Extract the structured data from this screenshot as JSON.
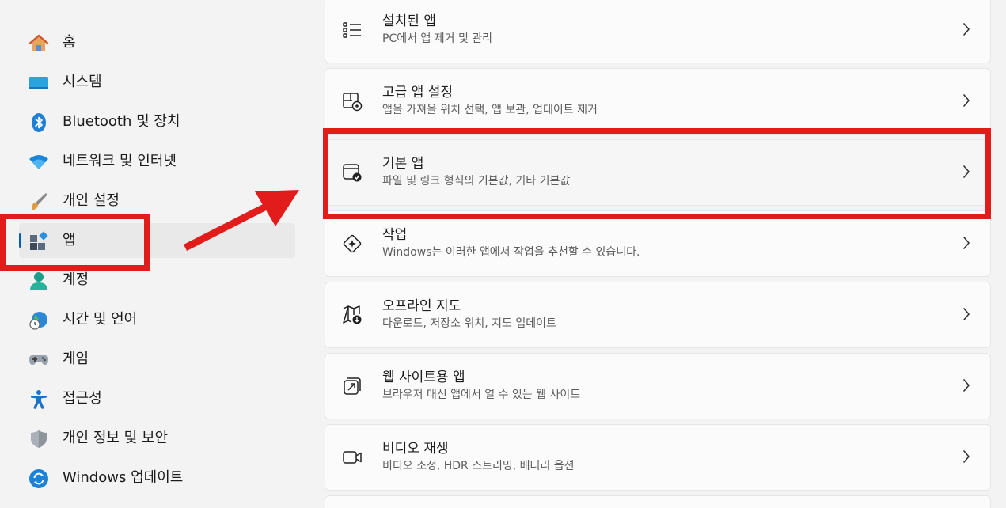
{
  "sidebar": {
    "items": [
      {
        "label": "홈",
        "icon": "home-icon"
      },
      {
        "label": "시스템",
        "icon": "system-icon"
      },
      {
        "label": "Bluetooth 및 장치",
        "icon": "bluetooth-icon"
      },
      {
        "label": "네트워크 및 인터넷",
        "icon": "wifi-icon"
      },
      {
        "label": "개인 설정",
        "icon": "brush-icon"
      },
      {
        "label": "앱",
        "icon": "apps-icon",
        "selected": true
      },
      {
        "label": "계정",
        "icon": "account-icon"
      },
      {
        "label": "시간 및 언어",
        "icon": "globe-clock-icon"
      },
      {
        "label": "게임",
        "icon": "gamepad-icon"
      },
      {
        "label": "접근성",
        "icon": "accessibility-icon"
      },
      {
        "label": "개인 정보 및 보안",
        "icon": "shield-icon"
      },
      {
        "label": "Windows 업데이트",
        "icon": "update-icon"
      }
    ]
  },
  "main": {
    "cards": [
      {
        "title": "설치된 앱",
        "subtitle": "PC에서 앱 제거 및 관리",
        "icon": "list-icon"
      },
      {
        "title": "고급 앱 설정",
        "subtitle": "앱을 가져올 위치 선택, 앱 보관, 업데이트 제거",
        "icon": "advanced-apps-icon"
      },
      {
        "title": "기본 앱",
        "subtitle": "파일 및 링크 형식의 기본값, 기타 기본값",
        "icon": "default-apps-icon"
      },
      {
        "title": "작업",
        "subtitle": "Windows는 이러한 앱에서 작업을 추천할 수 있습니다.",
        "icon": "actions-icon"
      },
      {
        "title": "오프라인 지도",
        "subtitle": "다운로드, 저장소 위치, 지도 업데이트",
        "icon": "offline-map-icon"
      },
      {
        "title": "웹 사이트용 앱",
        "subtitle": "브라우저 대신 앱에서 열 수 있는 웹 사이트",
        "icon": "open-external-icon"
      },
      {
        "title": "비디오 재생",
        "subtitle": "비디오 조정, HDR 스트리밍, 배터리 옵션",
        "icon": "video-icon"
      }
    ]
  },
  "colors": {
    "accent": "#005fb8",
    "annotation_red": "#e21b1b"
  }
}
